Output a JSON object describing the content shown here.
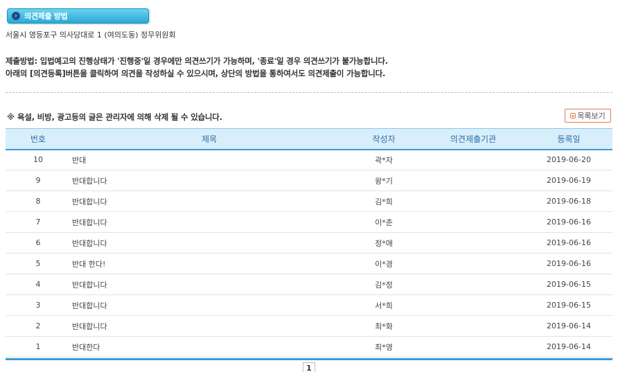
{
  "section": {
    "title": "의견제출 방법",
    "arrow": "›"
  },
  "address": "서울시 영등포구 의사당대로 1 (여의도동) 정무위원회",
  "notice": {
    "line1": "제출방법: 입법예고의 진행상태가 '진행중'일 경우에만 의견쓰기가 가능하며, '종료'일 경우 의견쓰기가 불가능합니다.",
    "line2": "아래의 [의견등록]버튼을 클릭하여 의견을 작성하실 수 있으시며, 상단의 방법을 통하여서도 의견제출이 가능합니다."
  },
  "warning": {
    "mark": "※",
    "text": "욕설, 비방, 광고등의 글은 관리자에 의해 삭제 될 수 있습니다."
  },
  "list_button": "목록보기",
  "table": {
    "headers": {
      "no": "번호",
      "title": "제목",
      "author": "작성자",
      "org": "의견제출기관",
      "date": "등록일"
    },
    "rows": [
      {
        "no": "10",
        "title": "반대",
        "author": "곽*자",
        "org": "",
        "date": "2019-06-20"
      },
      {
        "no": "9",
        "title": "반대합니다",
        "author": "왕*기",
        "org": "",
        "date": "2019-06-19"
      },
      {
        "no": "8",
        "title": "반대합니다",
        "author": "김*희",
        "org": "",
        "date": "2019-06-18"
      },
      {
        "no": "7",
        "title": "반대합니다",
        "author": "이*춘",
        "org": "",
        "date": "2019-06-16"
      },
      {
        "no": "6",
        "title": "반대합니다",
        "author": "정*애",
        "org": "",
        "date": "2019-06-16"
      },
      {
        "no": "5",
        "title": "반대 한다!",
        "author": "이*경",
        "org": "",
        "date": "2019-06-16"
      },
      {
        "no": "4",
        "title": "반대합니다",
        "author": "김*정",
        "org": "",
        "date": "2019-06-15"
      },
      {
        "no": "3",
        "title": "반대합니다",
        "author": "서*희",
        "org": "",
        "date": "2019-06-15"
      },
      {
        "no": "2",
        "title": "반대합니다",
        "author": "최*화",
        "org": "",
        "date": "2019-06-14"
      },
      {
        "no": "1",
        "title": "반대한다",
        "author": "최*영",
        "org": "",
        "date": "2019-06-14"
      }
    ]
  },
  "pagination": {
    "current": "1"
  }
}
